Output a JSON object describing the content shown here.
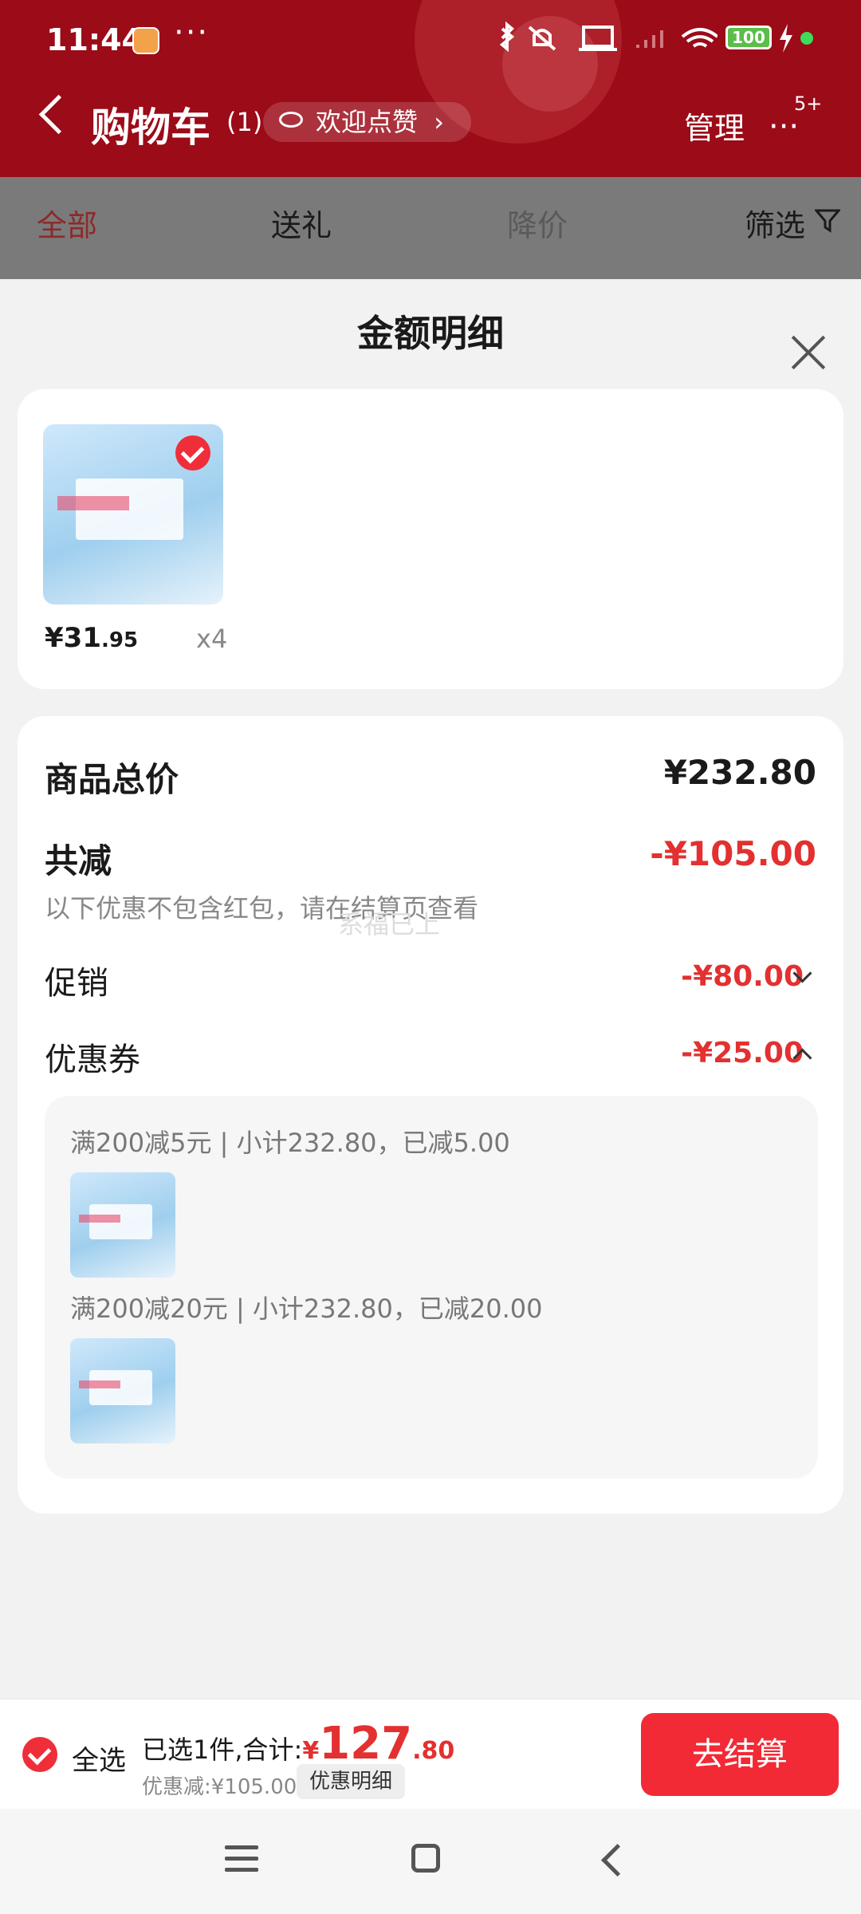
{
  "status_bar": {
    "time": "11:44",
    "more": "···",
    "battery": "100"
  },
  "header": {
    "title": "购物车",
    "count": "(1)",
    "praise_label": "欢迎点赞",
    "praise_arrow": "›",
    "manage_label": "管理",
    "more_dots": "···",
    "more_badge": "5+"
  },
  "tabs": [
    {
      "label": "全部",
      "active": true
    },
    {
      "label": "送礼"
    },
    {
      "label": "降价"
    },
    {
      "label": "筛选"
    }
  ],
  "sheet": {
    "title": "金额明细",
    "product": {
      "price_int": "¥31",
      "price_dec": ".95",
      "qty": "x4",
      "selected": true
    },
    "summary": {
      "total_label": "商品总价",
      "total_value": "¥232.80",
      "discount_label": "共减",
      "discount_value": "-¥105.00",
      "note": "以下优惠不包含红包，请在结算页查看",
      "watermark": "系福已上",
      "promo_label": "促销",
      "promo_value": "-¥80.00",
      "coupon_label": "优惠券",
      "coupon_value": "-¥25.00"
    },
    "coupons": [
      {
        "line": "满200减5元 | 小计232.80，已减5.00"
      },
      {
        "line": "满200减20元 | 小计232.80，已减20.00"
      }
    ]
  },
  "bottom": {
    "select_all": "全选",
    "selected_text": "已选1件,合计:",
    "currency": "¥",
    "total_int": "127",
    "total_dec": ".80",
    "discount_text": "优惠减:¥105.00",
    "detail_tag": "优惠明细",
    "checkout": "去结算"
  },
  "colors": {
    "header_red": "#9b0b18",
    "accent_red": "#f22a36",
    "price_red": "#e33030"
  }
}
